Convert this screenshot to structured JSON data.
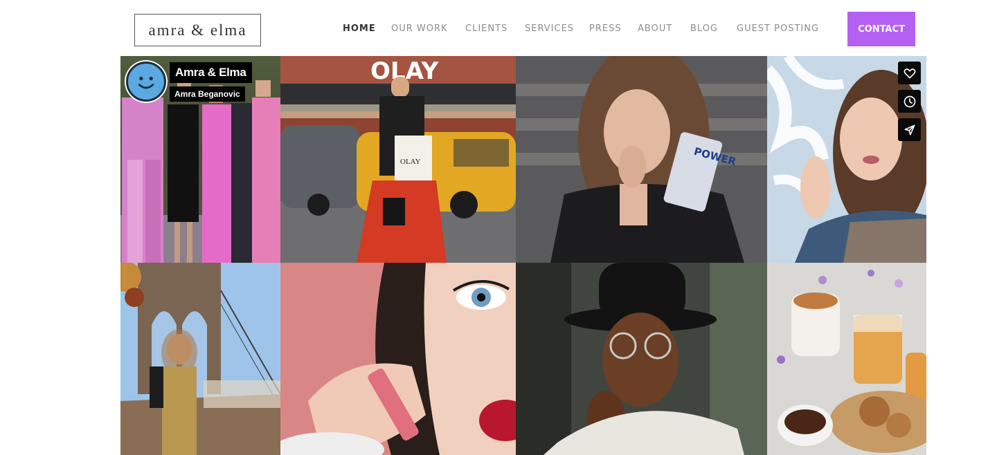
{
  "header": {
    "logo_text": "amra & elma",
    "nav": [
      {
        "label": "HOME"
      },
      {
        "label": "OUR WORK"
      },
      {
        "label": "CLIENTS"
      },
      {
        "label": "SERVICES"
      },
      {
        "label": "PRESS"
      },
      {
        "label": "ABOUT"
      },
      {
        "label": "BLOG"
      },
      {
        "label": "GUEST POSTING"
      }
    ],
    "contact_label": "CONTACT",
    "contact_color": "#b460f2"
  },
  "profile": {
    "title": "Amra & Elma",
    "subtitle": "Amra Beganovic"
  },
  "gallery": {
    "tiles": [
      {
        "subject": "fashion-show-models"
      },
      {
        "subject": "olay-street-fashion"
      },
      {
        "subject": "woman-eating-chocolate"
      },
      {
        "subject": "woman-winter-snow"
      },
      {
        "subject": "woman-brooklyn-bridge"
      },
      {
        "subject": "lipstick-closeup"
      },
      {
        "subject": "man-black-hat"
      },
      {
        "subject": "coffee-nuts-tea"
      }
    ]
  },
  "actions": {
    "icons": [
      "heart-icon",
      "clock-icon",
      "send-icon"
    ]
  }
}
